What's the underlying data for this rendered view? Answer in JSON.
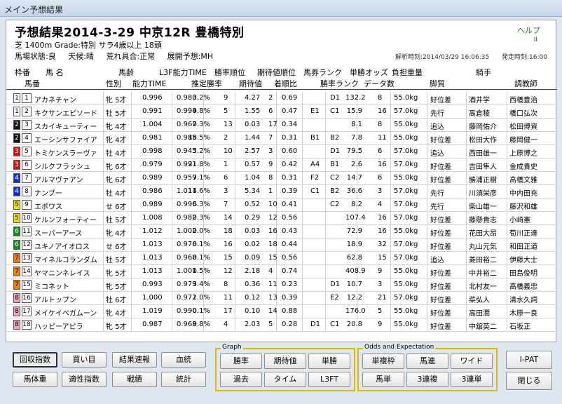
{
  "window": {
    "title": "メイン予想結果"
  },
  "header": {
    "title": "予想結果2014-3-29 中京12R 豊橋特別",
    "help": "ヘルプ",
    "help_sub": "II",
    "subtitle": "芝 1400m  Grade:特別 サラ4歳以上 18頭",
    "conditions": [
      "馬場状態:良",
      "天候:晴",
      "荒れ具合:正常",
      "展開予想:MH"
    ],
    "analysis_time": "解析時刻:2014/03/29 16:06:35",
    "post_time": "発走時刻:16:00"
  },
  "columns_top": {
    "waku": "枠番",
    "horse": "馬  名",
    "age_label": "馬齢",
    "l3f": "L3F能力TIME",
    "win_rank": "勝率順位",
    "ev_rank": "期待値順位",
    "bet_rank": "馬券ランク",
    "odds": "単勝オッズ",
    "weight": "負担重量",
    "jockey": "騎手"
  },
  "columns_bottom": {
    "umaban": "馬番",
    "sex": "性別",
    "ability": "能力TIME",
    "est_win": "推定勝率",
    "ev": "期待値",
    "pop_ratio": "着順比",
    "win_rank2": "勝率ランク",
    "data_count": "データ数",
    "style": "脚質",
    "trainer": "調教師"
  },
  "rows": [
    {
      "waku": "1",
      "uma": "1",
      "name": "アカネチャン",
      "sex": "牝 5才",
      "ab": "0.996",
      "l3f": "0.980",
      "win": "3.2%",
      "wr": "9",
      "ev": "4.27",
      "er": "2",
      "ratio": "0.69",
      "b1": "",
      "b2": "D1",
      "odds": "132.2",
      "dc": "8",
      "wt": "55.0kg",
      "sty": "好位差",
      "jk": "酒井学",
      "tr": "西橋豊治"
    },
    {
      "waku": "1",
      "uma": "2",
      "name": "キクサンエピソード",
      "sex": "牡 5才",
      "ab": "0.991",
      "l3f": "0.994",
      "win": "9.8%",
      "wr": "5",
      "ev": "1.55",
      "er": "6",
      "ratio": "0.47",
      "b1": "E1",
      "b2": "C1",
      "odds": "15.9",
      "dc": "16",
      "wt": "57.0kg",
      "sty": "先行",
      "jk": "高倉稜",
      "tr": "橋口弘次"
    },
    {
      "waku": "2",
      "uma": "3",
      "name": "スカイキューティー",
      "sex": "牝 4才",
      "ab": "1.004",
      "l3f": "0.967",
      "win": "0.3%",
      "wr": "13",
      "ev": "0.03",
      "er": "17",
      "ratio": "0.34",
      "b1": "",
      "b2": "",
      "odds": "8.1",
      "dc": "8",
      "wt": "55.0kg",
      "sty": "追込",
      "jk": "藤岡佑介",
      "tr": "松田博資"
    },
    {
      "waku": "2",
      "uma": "4",
      "name": "エーシンサファイア",
      "sex": "牝 4才",
      "ab": "0.981",
      "l3f": "0.985",
      "win": "18.5%",
      "wr": "2",
      "ev": "1.44",
      "er": "7",
      "ratio": "0.31",
      "b1": "B1",
      "b2": "B2",
      "odds": "7.8",
      "dc": "11",
      "wt": "55.0kg",
      "sty": "好位差",
      "jk": "松田大作",
      "tr": "藤岡健一"
    },
    {
      "waku": "3",
      "uma": "5",
      "name": "トミケンスラーヴァ",
      "sex": "牡 4才",
      "ab": "0.998",
      "l3f": "0.945",
      "win": "3.2%",
      "wr": "10",
      "ev": "2.57",
      "er": "3",
      "ratio": "0.60",
      "b1": "",
      "b2": "D1",
      "odds": "79.5",
      "dc": "6",
      "wt": "57.0kg",
      "sty": "追込",
      "jk": "西田雄一",
      "tr": "上原博之"
    },
    {
      "waku": "3",
      "uma": "6",
      "name": "シルクフラッシュ",
      "sex": "牝 6才",
      "ab": "0.979",
      "l3f": "0.991",
      "win": "21.8%",
      "wr": "1",
      "ev": "0.57",
      "er": "9",
      "ratio": "0.42",
      "b1": "A4",
      "b2": "B1",
      "odds": "2.6",
      "dc": "16",
      "wt": "57.0kg",
      "sty": "好位差",
      "jk": "吉田隼人",
      "tr": "金成貴史"
    },
    {
      "waku": "4",
      "uma": "7",
      "name": "アルマヴァアン",
      "sex": "牝 6才",
      "ab": "0.989",
      "l3f": "0.959",
      "win": "7.1%",
      "wr": "6",
      "ev": "1.04",
      "er": "8",
      "ratio": "0.31",
      "b1": "F2",
      "b2": "C2",
      "odds": "14.7",
      "dc": "6",
      "wt": "55.0kg",
      "sty": "好位差",
      "jk": "勝浦正樹",
      "tr": "高橋文雅"
    },
    {
      "waku": "4",
      "uma": "8",
      "name": "ナンブー",
      "sex": "牡 4才",
      "ab": "0.986",
      "l3f": "1.011",
      "win": "14.6%",
      "wr": "3",
      "ev": "5.34",
      "er": "1",
      "ratio": "0.39",
      "b1": "C1",
      "b2": "B2",
      "odds": "36.6",
      "dc": "3",
      "wt": "57.0kg",
      "sty": "先行",
      "jk": "川須栄彦",
      "tr": "中内田充"
    },
    {
      "waku": "5",
      "uma": "9",
      "name": "エポワス",
      "sex": "せ 6才",
      "ab": "0.989",
      "l3f": "0.990",
      "win": "6.3%",
      "wr": "7",
      "ev": "0.52",
      "er": "10",
      "ratio": "0.41",
      "b1": "",
      "b2": "C2",
      "odds": "8.2",
      "dc": "4",
      "wt": "57.0kg",
      "sty": "先行",
      "jk": "柴山雄一",
      "tr": "藤沢和雄"
    },
    {
      "waku": "5",
      "uma": "10",
      "name": "ケルンフォーティー",
      "sex": "牡 5才",
      "ab": "1.008",
      "l3f": "0.982",
      "win": "0.3%",
      "wr": "14",
      "ev": "0.29",
      "er": "12",
      "ratio": "0.56",
      "b1": "",
      "b2": "",
      "odds": "107.4",
      "dc": "16",
      "wt": "57.0kg",
      "sty": "好位差",
      "jk": "藤懸貴志",
      "tr": "小崎憲"
    },
    {
      "waku": "6",
      "uma": "11",
      "name": "スーパーアース",
      "sex": "牝 4才",
      "ab": "1.012",
      "l3f": "1.002",
      "win": "0.0%",
      "wr": "18",
      "ev": "0.03",
      "er": "16",
      "ratio": "0.43",
      "b1": "",
      "b2": "",
      "odds": "72.9",
      "dc": "16",
      "wt": "55.0kg",
      "sty": "好位差",
      "jk": "花田大昂",
      "tr": "荀川正達"
    },
    {
      "waku": "6",
      "uma": "12",
      "name": "ユキノアイオロス",
      "sex": "せ 6才",
      "ab": "1.013",
      "l3f": "0.976",
      "win": "0.1%",
      "wr": "16",
      "ev": "0.02",
      "er": "18",
      "ratio": "0.44",
      "b1": "",
      "b2": "",
      "odds": "18.9",
      "dc": "32",
      "wt": "57.0kg",
      "sty": "好位差",
      "jk": "丸山元気",
      "tr": "和田正道"
    },
    {
      "waku": "7",
      "uma": "13",
      "name": "マイネルコランダム",
      "sex": "牡 5才",
      "ab": "1.013",
      "l3f": "0.968",
      "win": "0.1%",
      "wr": "15",
      "ev": "0.09",
      "er": "15",
      "ratio": "0.56",
      "b1": "",
      "b2": "",
      "odds": "62.8",
      "dc": "15",
      "wt": "57.0kg",
      "sty": "追込",
      "jk": "菱田裕二",
      "tr": "伊藤大士"
    },
    {
      "waku": "7",
      "uma": "14",
      "name": "ヤマニンネレイス",
      "sex": "牝 5才",
      "ab": "1.013",
      "l3f": "1.001",
      "win": "0.5%",
      "wr": "12",
      "ev": "2.18",
      "er": "4",
      "ratio": "0.74",
      "b1": "",
      "b2": "",
      "odds": "408.9",
      "dc": "9",
      "wt": "55.0kg",
      "sty": "好位差",
      "jk": "中井裕二",
      "tr": "田島俊明"
    },
    {
      "waku": "7",
      "uma": "15",
      "name": "ミコネット",
      "sex": "牝 5才",
      "ab": "0.993",
      "l3f": "0.979",
      "win": "3.4%",
      "wr": "8",
      "ev": "0.36",
      "er": "11",
      "ratio": "0.23",
      "b1": "",
      "b2": "D1",
      "odds": "10.7",
      "dc": "3",
      "wt": "55.0kg",
      "sty": "好位差",
      "jk": "北村友一",
      "tr": "高橋義忠"
    },
    {
      "waku": "8",
      "uma": "16",
      "name": "アルトップン",
      "sex": "牡 6才",
      "ab": "1.000",
      "l3f": "0.972",
      "win": "1.0%",
      "wr": "11",
      "ev": "0.12",
      "er": "13",
      "ratio": "0.39",
      "b1": "",
      "b2": "E2",
      "odds": "12.2",
      "dc": "21",
      "wt": "57.0kg",
      "sty": "好位差",
      "jk": "菜弘人",
      "tr": "清水久詞"
    },
    {
      "waku": "8",
      "uma": "17",
      "name": "メイケイペガムーン",
      "sex": "牝 4才",
      "ab": "1.019",
      "l3f": "0.990",
      "win": "0.1%",
      "wr": "17",
      "ev": "0.10",
      "er": "14",
      "ratio": "0.88",
      "b1": "",
      "b2": "",
      "odds": "176.0",
      "dc": "5",
      "wt": "55.0kg",
      "sty": "好位差",
      "jk": "高田潤",
      "tr": "木原一良"
    },
    {
      "waku": "8",
      "uma": "18",
      "name": "ハッピーアピラ",
      "sex": "牝 5才",
      "ab": "0.987",
      "l3f": "0.968",
      "win": "9.8%",
      "wr": "4",
      "ev": "2.03",
      "er": "5",
      "ratio": "0.28",
      "b1": "D1",
      "b2": "C1",
      "odds": "20.8",
      "dc": "9",
      "wt": "55.0kg",
      "sty": "好位差",
      "jk": "中舘英二",
      "tr": "石坂正"
    }
  ],
  "waku_colors": {
    "1": "#ffffff",
    "2": "#111111",
    "3": "#e01010",
    "4": "#1030d0",
    "5": "#f0e000",
    "6": "#109020",
    "7": "#f08000",
    "8": "#f4a0b8"
  },
  "buttons_left": {
    "recovery": "回収指数",
    "buy": "買い目",
    "result_flash": "結果速報",
    "pedigree": "血統",
    "body_weight": "馬体重",
    "aptitude": "適性指数",
    "record": "戦績",
    "stats": "統計"
  },
  "graph": {
    "label": "Graph",
    "win_rate": "勝率",
    "expected": "期待値",
    "tansho": "単勝",
    "past": "過去",
    "time": "タイム",
    "l3ft": "L3FT"
  },
  "odds_group": {
    "label": "Odds and Expectation",
    "wakuren": "単複枠",
    "umaren": "馬連",
    "wide": "ワイド",
    "umatan": "馬単",
    "trio": "3連複",
    "trifecta": "3連単"
  },
  "buttons_right": {
    "ipat": "I-PAT",
    "close": "閉じる"
  }
}
